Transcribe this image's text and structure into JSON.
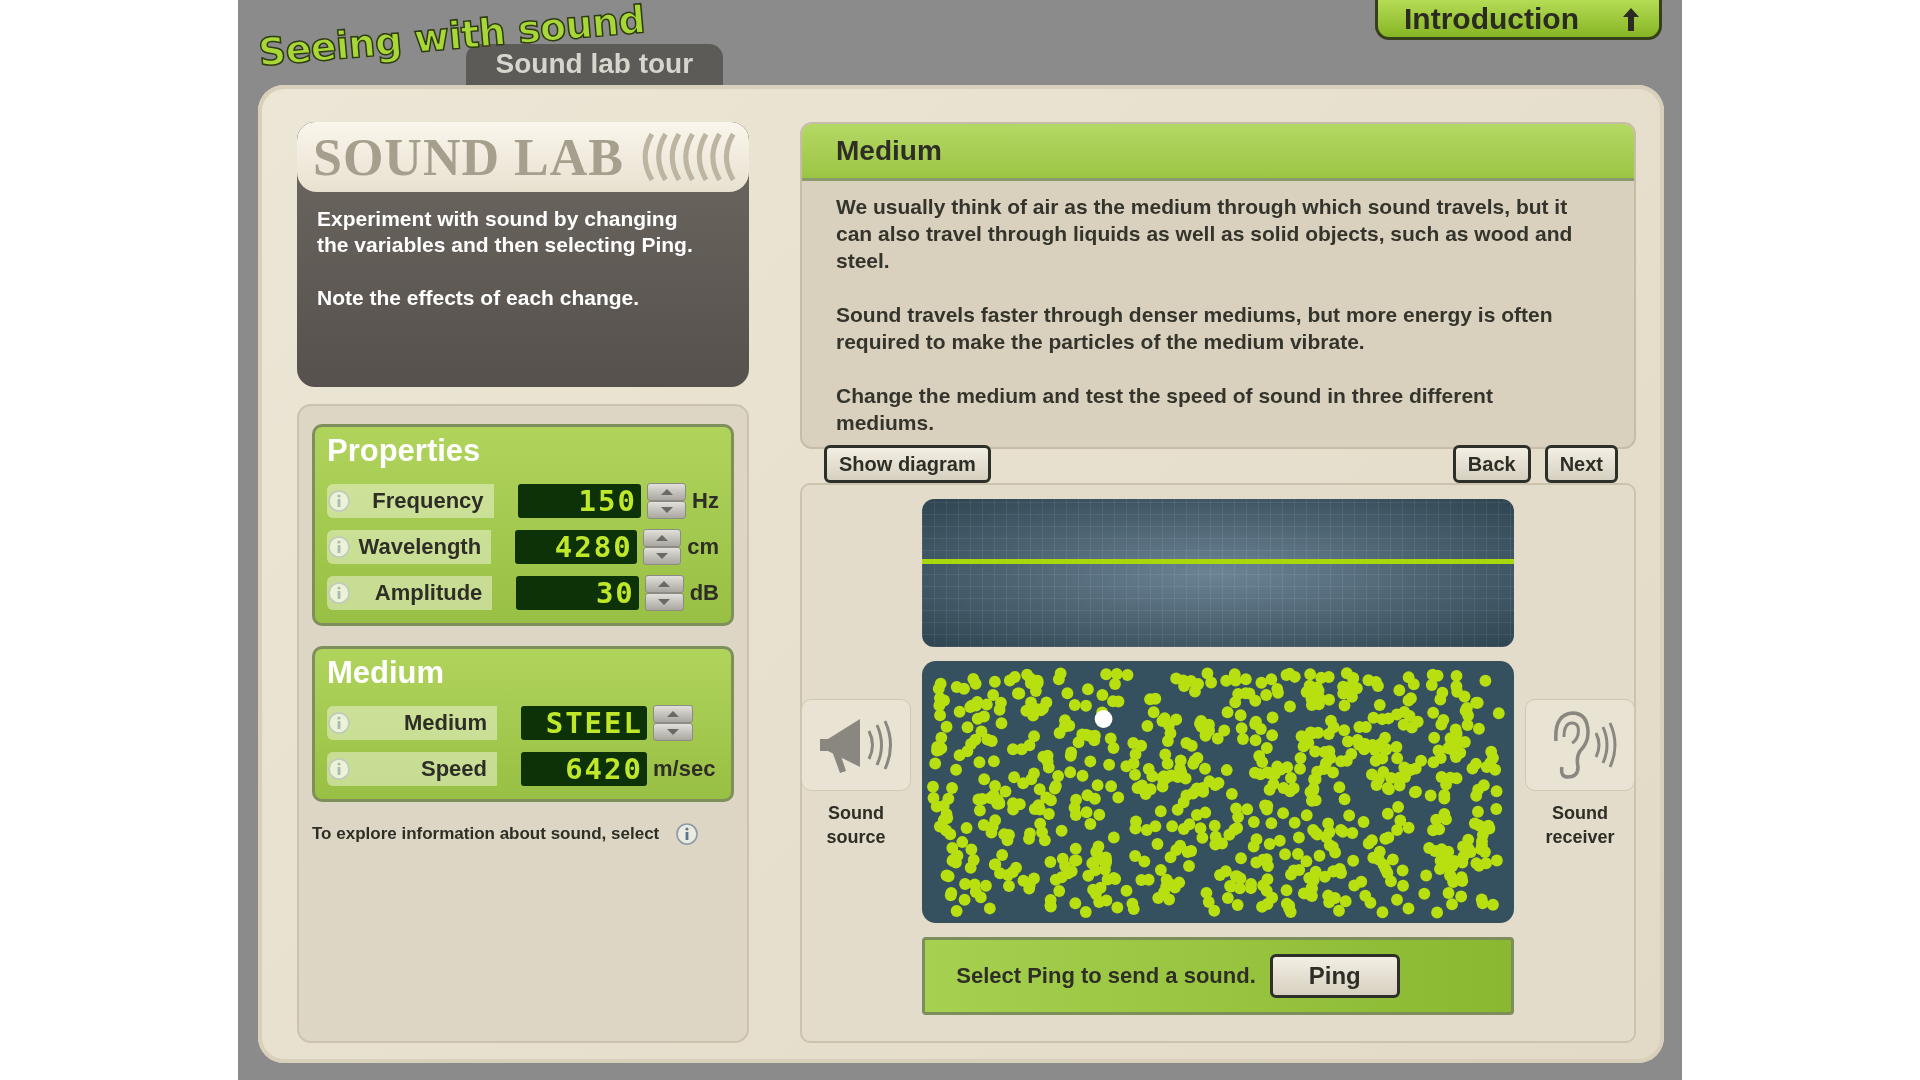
{
  "header": {
    "title": "Seeing with sound",
    "subtitle": "Sound lab tour",
    "nav_button": "Introduction"
  },
  "sound_lab": {
    "heading": "SOUND LAB",
    "paragraphs": [
      "Experiment with sound by changing the variables and then selecting **Ping**.",
      "Note the effects of each change."
    ]
  },
  "properties": {
    "title": "Properties",
    "rows": [
      {
        "label": "Frequency",
        "value": "150",
        "unit": "Hz",
        "kind": "stepper"
      },
      {
        "label": "Wavelength",
        "value": "4280",
        "unit": "cm",
        "kind": "stepper"
      },
      {
        "label": "Amplitude",
        "value": "30",
        "unit": "dB",
        "kind": "stepper"
      }
    ]
  },
  "medium": {
    "title": "Medium",
    "rows": [
      {
        "label": "Medium",
        "value": "STEEL",
        "kind": "stepper"
      },
      {
        "label": "Speed",
        "value": "6420",
        "unit": "m/sec",
        "kind": "readout"
      }
    ]
  },
  "footer_note": "To explore information about sound, select",
  "info": {
    "title": "Medium",
    "paragraphs": [
      "We usually think of air as the medium through which sound travels, but it can also travel through liquids as well as solid objects, such as wood and steel.",
      "Sound travels faster through denser mediums, but more energy is often required to make the particles of the medium vibrate.",
      "Change the medium and test the speed of sound in three different mediums."
    ]
  },
  "buttons": {
    "diagram": "Show diagram",
    "back": "Back",
    "next": "Next"
  },
  "diagram": {
    "source_label": "Sound source",
    "receiver_label": "Sound receiver"
  },
  "ping": {
    "text": "Select **Ping** to send a sound.",
    "button": "Ping"
  }
}
